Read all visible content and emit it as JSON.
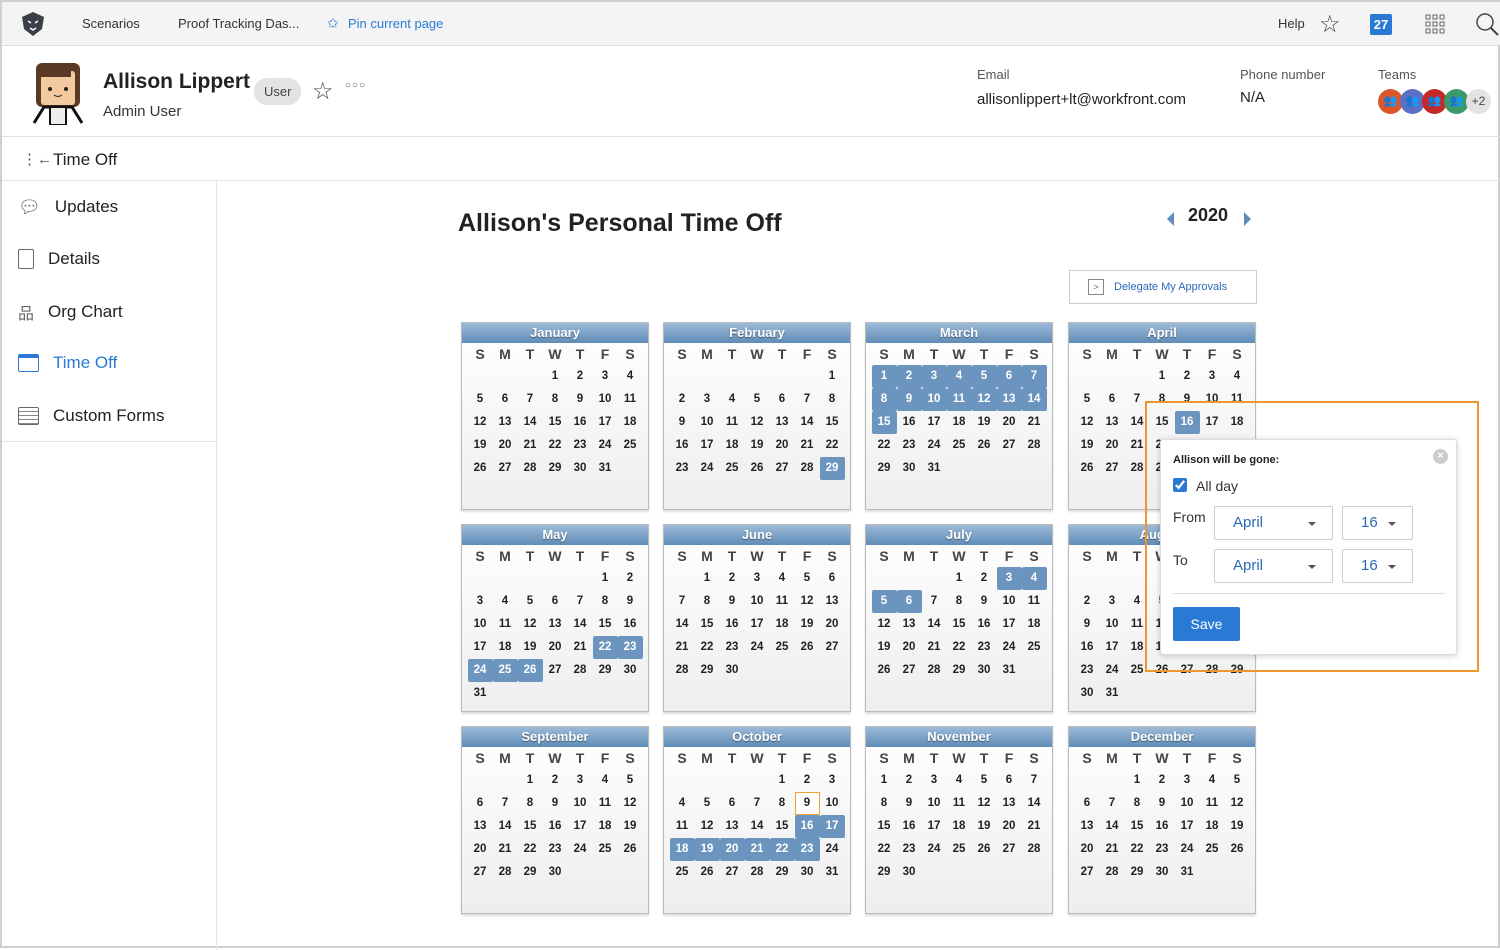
{
  "topbar": {
    "scenarios": "Scenarios",
    "proof": "Proof Tracking Das...",
    "pin": "Pin current page",
    "help": "Help",
    "notifications": "27"
  },
  "user": {
    "name": "Allison Lippert",
    "badge": "User",
    "role": "Admin User",
    "email_label": "Email",
    "email": "allisonlippert+lt@workfront.com",
    "phone_label": "Phone number",
    "phone": "N/A",
    "teams_label": "Teams",
    "teams_more": "+2",
    "team_colors": [
      "#d9572b",
      "#5b6fc4",
      "#c62828",
      "#3a9a6a"
    ]
  },
  "subbar": {
    "title": "Time Off"
  },
  "sidebar": {
    "items": [
      {
        "label": "Updates"
      },
      {
        "label": "Details"
      },
      {
        "label": "Org Chart"
      },
      {
        "label": "Time Off"
      },
      {
        "label": "Custom Forms"
      }
    ]
  },
  "main": {
    "title": "Allison's Personal Time Off",
    "year": "2020",
    "delegate": "Delegate My Approvals"
  },
  "calendar": {
    "dow": [
      "S",
      "M",
      "T",
      "W",
      "T",
      "F",
      "S"
    ],
    "months": [
      {
        "name": "January",
        "off": []
      },
      {
        "name": "February",
        "off": [
          29
        ]
      },
      {
        "name": "March",
        "off": [
          1,
          2,
          3,
          4,
          5,
          6,
          7,
          8,
          9,
          10,
          11,
          12,
          13,
          14,
          15
        ]
      },
      {
        "name": "April",
        "off": [
          16
        ]
      },
      {
        "name": "May",
        "off": [
          22,
          23,
          24,
          25,
          26
        ]
      },
      {
        "name": "June",
        "off": []
      },
      {
        "name": "July",
        "off": [
          3,
          4,
          5,
          6
        ]
      },
      {
        "name": "August",
        "off": []
      },
      {
        "name": "September",
        "off": []
      },
      {
        "name": "October",
        "off": [
          16,
          17,
          18,
          19,
          20,
          21,
          22,
          23
        ],
        "today": 9
      },
      {
        "name": "November",
        "off": []
      },
      {
        "name": "December",
        "off": []
      }
    ]
  },
  "popup": {
    "heading": "Allison will be gone:",
    "allday": "All day",
    "allday_checked": true,
    "from_label": "From",
    "to_label": "To",
    "from_month": "April",
    "from_day": "16",
    "to_month": "April",
    "to_day": "16",
    "save": "Save"
  },
  "colors": {
    "accent": "#2a7ad5",
    "highlight": "#f0962a",
    "off": "#6b95bf"
  }
}
